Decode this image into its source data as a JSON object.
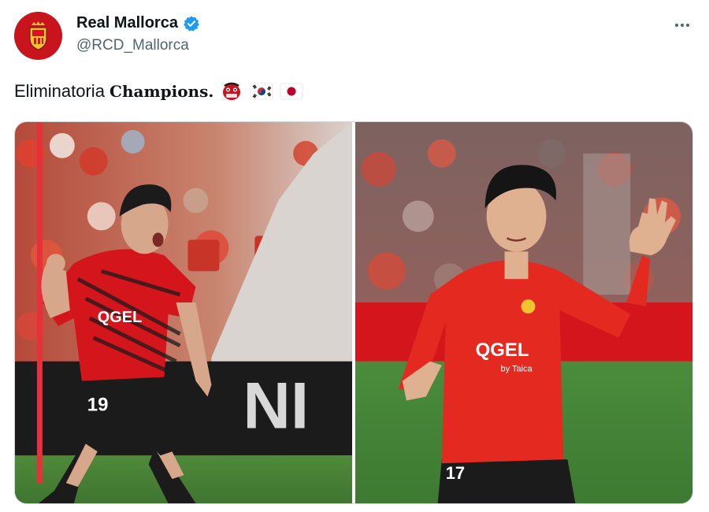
{
  "author": {
    "display_name": "Real Mallorca",
    "handle": "@RCD_Mallorca",
    "verified": true,
    "avatar_icon": "real-mallorca-crest"
  },
  "tweet": {
    "text_plain": "Eliminatoria ",
    "text_bold": "Champions.",
    "emojis": [
      "ogre-emoji",
      "south-korea-flag-emoji",
      "japan-flag-emoji"
    ]
  },
  "media": {
    "photos": [
      {
        "left_player_number": "19",
        "sponsor": "QGEL"
      },
      {
        "right_player_number": "17",
        "sponsor": "QGEL",
        "sponsor_sub": "by Taica"
      }
    ],
    "background_letters": "NI"
  },
  "colors": {
    "brand_red": "#d4151c",
    "verified_blue": "#1d9bf0",
    "text_primary": "#0f1419",
    "text_secondary": "#536471"
  }
}
